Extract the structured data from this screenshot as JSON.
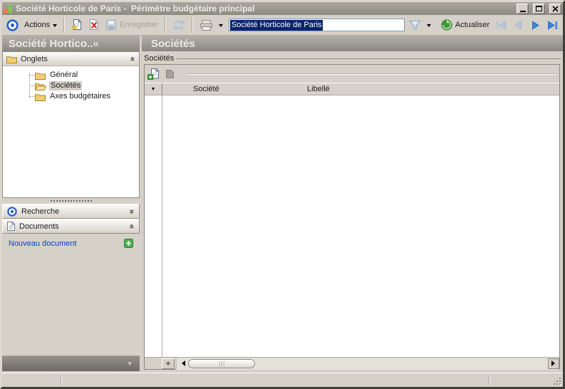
{
  "window": {
    "title": "Société Horticole de Paris -  Périmètre budgétaire principal"
  },
  "toolbar": {
    "actions_label": "Actions",
    "save_label": "Enregistrer",
    "perimeter_field_value": "Société Horticole de Paris",
    "refresh_label": "Actualiser"
  },
  "sidebar": {
    "title": "Société Hortico..",
    "tabs_section_label": "Onglets",
    "tree": [
      {
        "label": "Général",
        "selected": false
      },
      {
        "label": "Sociétés",
        "selected": true
      },
      {
        "label": "Axes budgétaires",
        "selected": false
      }
    ],
    "search_section_label": "Recherche",
    "documents_section_label": "Documents",
    "new_document_label": "Nouveau document"
  },
  "main": {
    "title": "Sociétés",
    "group_label": "Sociétés",
    "grid": {
      "columns": [
        "Société",
        "Libellé"
      ],
      "rows": [],
      "add_row_label": "+"
    }
  },
  "glyphs": {
    "chevron_double_left": "«",
    "chevron_double_up": "«",
    "chevron_double_down": "»",
    "triangle_down": "▼"
  },
  "icons": {
    "app_icon": "orange-green-blocks",
    "actions_icon": "blue-bullseye",
    "new_icon": "document-with-yellow-star",
    "delete_icon": "document-with-red-x",
    "save_icon": "floppy-disk-disabled",
    "sync_icon": "refresh-arrows-disabled",
    "print_icon": "printer-disabled",
    "filter_icon": "blue-funnel",
    "refresh_icon": "green-orb-arrow",
    "nav_first_icon": "first-record-disabled",
    "nav_prev_icon": "previous-record-disabled",
    "nav_next_icon": "next-record",
    "nav_last_icon": "last-record",
    "search_icon": "blue-bullseye",
    "documents_icon": "document",
    "new_document_icon": "green-plus",
    "grid_add_icon": "document-with-green-plus",
    "grid_delete_icon": "document-silhouette-disabled"
  },
  "colors": {
    "window_bg": "#d5d1c8",
    "titlebar": "#928f88",
    "caption_text": "#eceae5",
    "selection_bg": "#0a246a",
    "selection_text": "#ffffff",
    "link": "#0b3ed4",
    "accent_blue": "#2a5ec4",
    "green": "#3fa33f"
  }
}
